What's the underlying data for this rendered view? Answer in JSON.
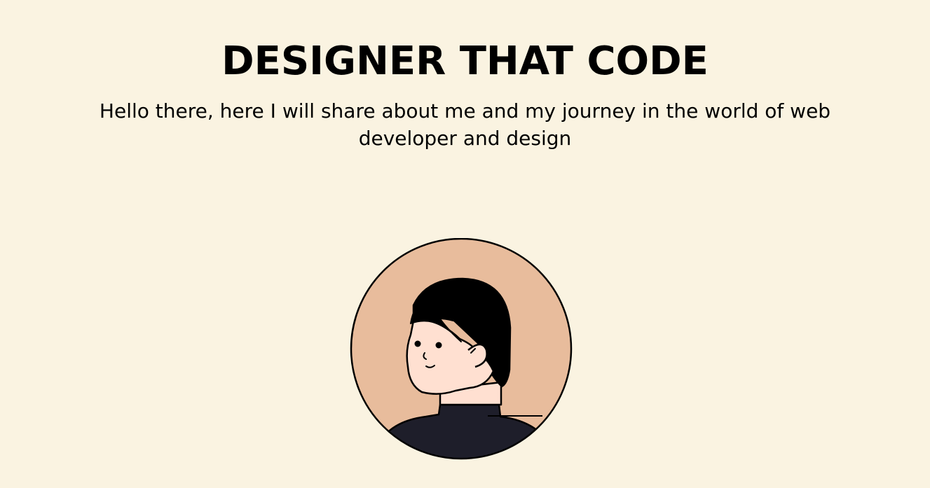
{
  "hero": {
    "title": "DESIGNER THAT CODE",
    "subtitle": "Hello there, here I will share about me and my journey in the world of web developer and design"
  },
  "avatar": {
    "icon": "person-avatar-illustration",
    "colors": {
      "page_background": "#FAF3E1",
      "circle": "#E8BC9C",
      "skin": "#FFE0D1",
      "hair": "#000000",
      "shirt": "#1E1E2A",
      "outline": "#000000"
    }
  }
}
